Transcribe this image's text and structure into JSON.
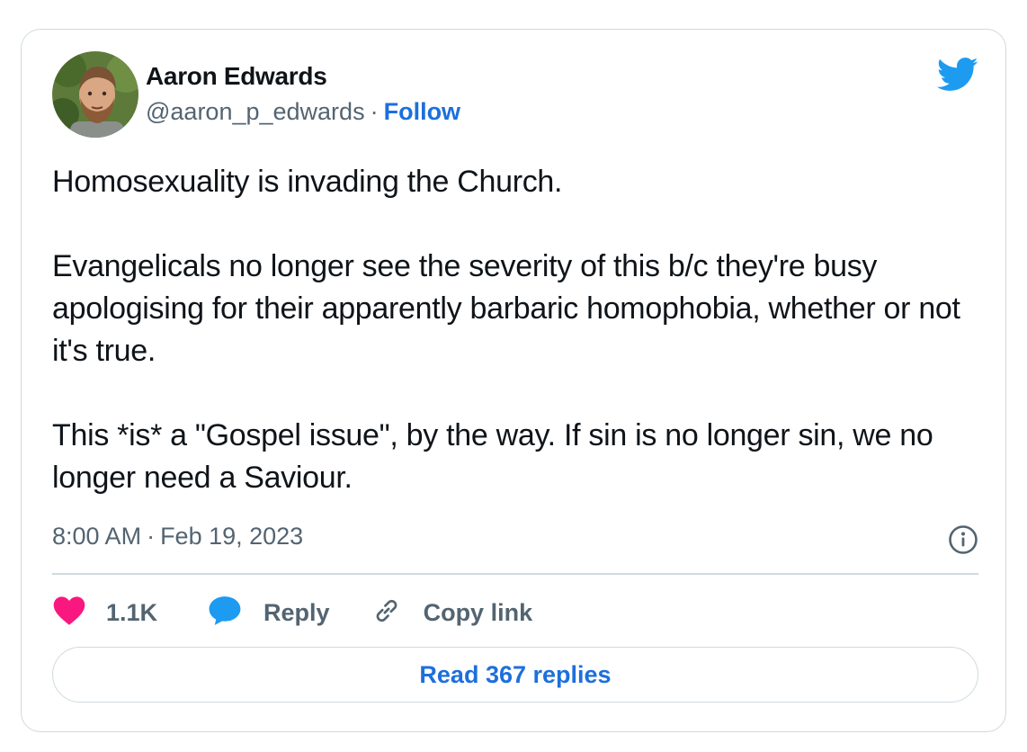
{
  "author": {
    "display_name": "Aaron Edwards",
    "handle": "@aaron_p_edwards",
    "separator": "·",
    "follow_label": "Follow"
  },
  "tweet": {
    "text": "Homosexuality is invading the Church.\n\nEvangelicals no longer see the severity of this b/c they're busy apologising for their apparently barbaric homophobia, whether or not it's true.\n\nThis *is* a \"Gospel issue\", by the way. If sin is no longer sin, we no longer need a Saviour.",
    "time": "8:00 AM",
    "separator": "·",
    "date": "Feb 19, 2023"
  },
  "actions": {
    "like_count": "1.1K",
    "reply_label": "Reply",
    "copy_link_label": "Copy link"
  },
  "footer": {
    "read_replies_label": "Read 367 replies"
  },
  "colors": {
    "brand": "#1d9bf0",
    "link": "#1d6fdc",
    "like": "#f91880",
    "muted_text": "#536471",
    "border": "#cfd9de"
  },
  "icons": [
    "twitter-bird-icon",
    "info-icon",
    "heart-icon",
    "reply-bubble-icon",
    "link-icon"
  ]
}
